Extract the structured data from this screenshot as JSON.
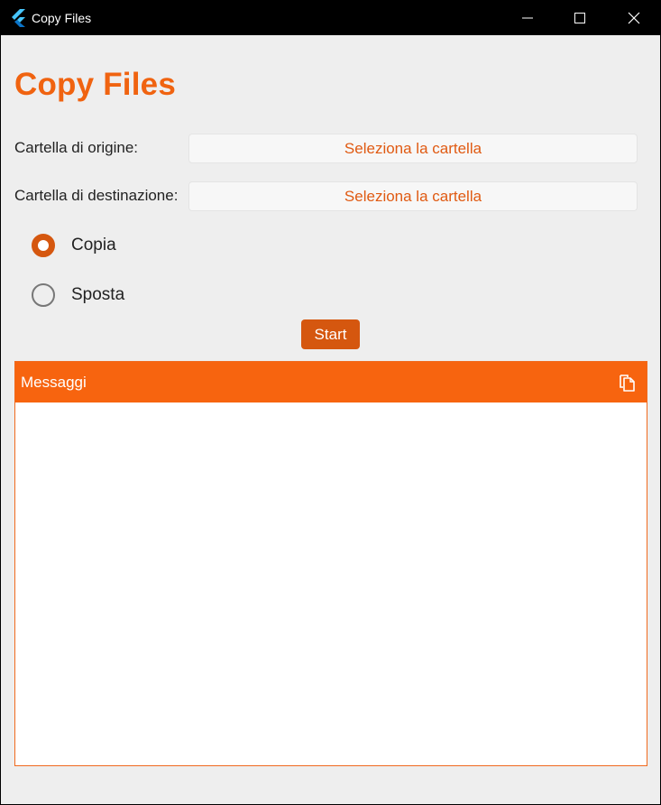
{
  "window": {
    "title": "Copy Files",
    "icons": [
      "flutter-logo-icon",
      "minimize-icon",
      "maximize-icon",
      "close-icon"
    ]
  },
  "main": {
    "heading": "Copy Files",
    "source": {
      "label": "Cartella di origine:",
      "button_label": "Seleziona la cartella"
    },
    "destination": {
      "label": "Cartella di destinazione:",
      "button_label": "Seleziona la cartella"
    },
    "mode_options": [
      {
        "label": "Copia",
        "selected": true
      },
      {
        "label": "Sposta",
        "selected": false
      }
    ],
    "start_label": "Start",
    "messages": {
      "title": "Messaggi",
      "copy_icon": "copy-icon",
      "content": ""
    }
  },
  "colors": {
    "accent": "#f7640f",
    "accent_dark": "#d5570f",
    "heading": "#f06310",
    "background": "#eeeeee",
    "titlebar": "#000000"
  }
}
